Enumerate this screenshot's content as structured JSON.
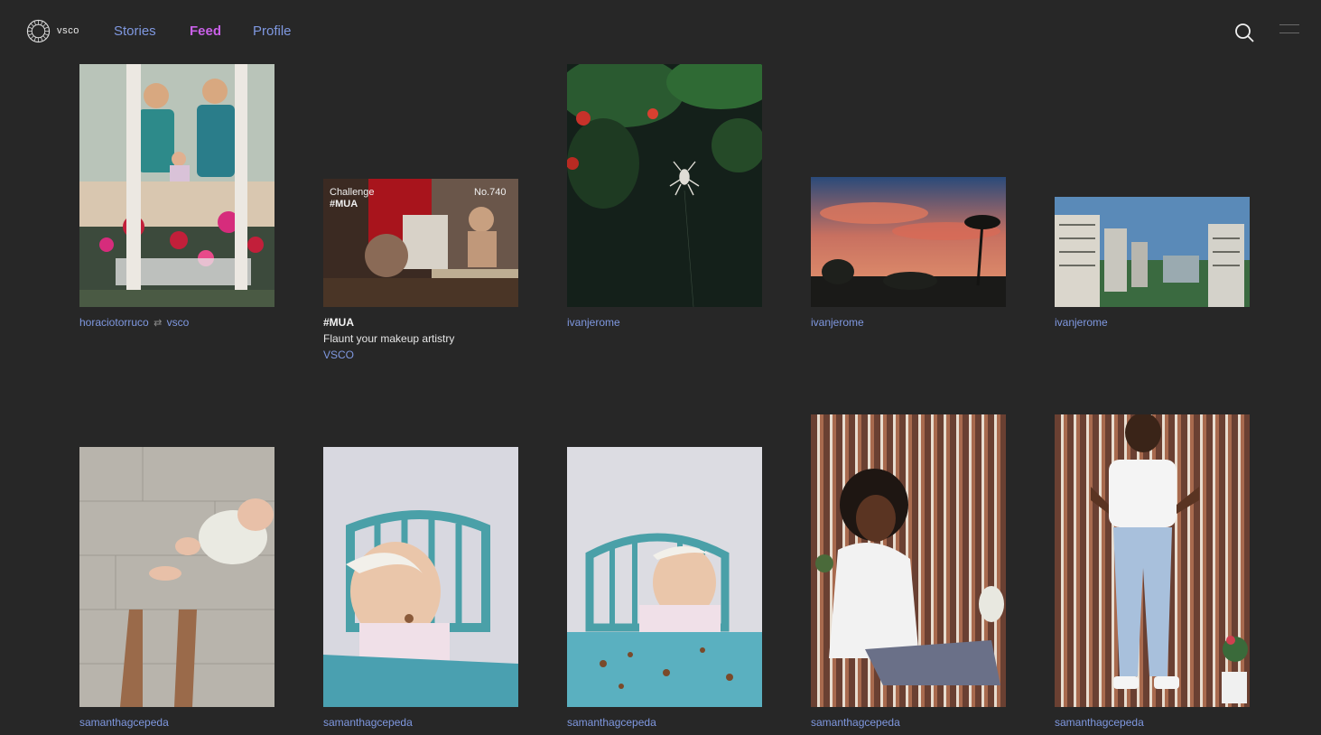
{
  "brand": {
    "name": "vsco"
  },
  "nav": [
    {
      "label": "Stories",
      "active": false
    },
    {
      "label": "Feed",
      "active": true
    },
    {
      "label": "Profile",
      "active": false
    }
  ],
  "header_icons": {
    "search": "search-icon",
    "menu": "menu-icon"
  },
  "colors": {
    "background": "#272727",
    "link": "#7f98e0",
    "active_nav": "#c960e8"
  },
  "feed": [
    {
      "user": "horaciotorruco",
      "reposted_from": "vsco",
      "repost_icon": "repost-icon"
    },
    {
      "challenge_tag": "Challenge",
      "challenge_hashtag": "#MUA",
      "challenge_no": "No.740",
      "title": "#MUA",
      "description": "Flaunt your makeup artistry",
      "brand": "VSCO"
    },
    {
      "user": "ivanjerome"
    },
    {
      "user": "ivanjerome"
    },
    {
      "user": "ivanjerome"
    },
    {
      "user": "samanthagcepeda"
    },
    {
      "user": "samanthagcepeda"
    },
    {
      "user": "samanthagcepeda"
    },
    {
      "user": "samanthagcepeda"
    },
    {
      "user": "samanthagcepeda"
    }
  ]
}
